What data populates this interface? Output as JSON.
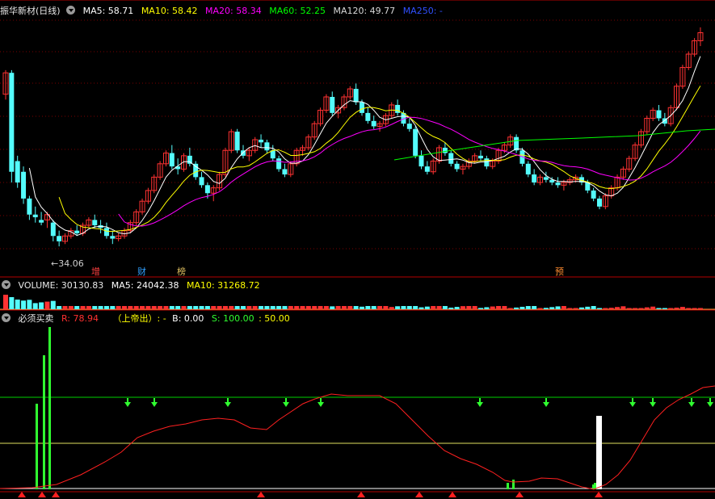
{
  "header": {
    "title": "振华新材(日线)",
    "ma": [
      {
        "label": "MA5: 58.71",
        "color": "#ffffff"
      },
      {
        "label": "MA10: 58.42",
        "color": "#ffff00"
      },
      {
        "label": "MA20: 58.34",
        "color": "#ff00ff"
      },
      {
        "label": "MA60: 52.25",
        "color": "#00ff00"
      },
      {
        "label": "MA120: 49.77",
        "color": "#d8d8d8"
      },
      {
        "label": "MA250: -",
        "color": "#3050ff"
      }
    ]
  },
  "price_panel": {
    "low_label": "34.06",
    "tags": [
      "增",
      "财",
      "榜",
      "预"
    ]
  },
  "volume_panel": {
    "title": "VOLUME: 30130.83",
    "ma5": "MA5: 24042.38",
    "ma10": "MA10: 31268.72"
  },
  "indicator_panel": {
    "title": "必须买卖",
    "r": "R: 78.94",
    "signal": "（上帝出）: -",
    "b": "B: 0.00",
    "s": "S: 100.00",
    "level": ": 50.00"
  },
  "colors": {
    "up": "#ff3232",
    "down": "#54fcfc",
    "grid": "#7a0000",
    "sep": "#b40000"
  },
  "chart_data": {
    "type": "candlestick",
    "title": "振华新材(日线)",
    "annotated_low": 34.06,
    "ma_values": {
      "MA5": 58.71,
      "MA10": 58.42,
      "MA20": 58.34,
      "MA60": 52.25,
      "MA120": 49.77
    },
    "volume": {
      "VOLUME": 30130.83,
      "MA5": 24042.38,
      "MA10": 31268.72
    },
    "indicator": {
      "R": 78.94,
      "B": 0.0,
      "S": 100.0,
      "level": 50.0
    },
    "candles_approx": [
      [
        62.5,
        67.0,
        61.5,
        66.5
      ],
      [
        66.5,
        67.0,
        46.0,
        48.0
      ],
      [
        50.0,
        51.0,
        45.0,
        46.0
      ],
      [
        48.0,
        49.0,
        42.0,
        43.0
      ],
      [
        43.0,
        43.5,
        39.0,
        40.0
      ],
      [
        40.0,
        41.5,
        38.5,
        39.5
      ],
      [
        39.0,
        40.5,
        38.0,
        38.5
      ],
      [
        39.0,
        40.5,
        37.5,
        40.0
      ],
      [
        38.5,
        39.0,
        35.0,
        36.0
      ],
      [
        36.0,
        37.0,
        34.06,
        35.0
      ],
      [
        35.0,
        36.5,
        34.5,
        36.0
      ],
      [
        36.0,
        37.5,
        35.5,
        37.0
      ],
      [
        37.0,
        38.0,
        36.0,
        36.5
      ],
      [
        36.5,
        38.5,
        36.0,
        38.0
      ],
      [
        38.0,
        39.5,
        37.5,
        39.0
      ],
      [
        39.0,
        40.0,
        37.5,
        38.0
      ],
      [
        38.0,
        39.0,
        36.5,
        37.5
      ],
      [
        37.5,
        38.5,
        35.5,
        36.0
      ],
      [
        36.0,
        37.0,
        34.5,
        35.5
      ],
      [
        35.5,
        36.5,
        35.0,
        36.0
      ],
      [
        36.0,
        37.5,
        35.5,
        37.0
      ],
      [
        37.0,
        39.0,
        36.5,
        38.5
      ],
      [
        38.5,
        41.0,
        38.0,
        40.5
      ],
      [
        40.5,
        43.0,
        40.0,
        42.5
      ],
      [
        42.5,
        45.0,
        42.0,
        44.5
      ],
      [
        44.5,
        47.5,
        44.0,
        47.0
      ],
      [
        47.0,
        50.0,
        46.5,
        49.5
      ],
      [
        49.5,
        52.0,
        49.0,
        51.5
      ],
      [
        51.5,
        53.0,
        48.5,
        49.0
      ],
      [
        49.0,
        50.5,
        47.5,
        48.5
      ],
      [
        48.5,
        51.5,
        48.0,
        51.0
      ],
      [
        51.0,
        52.5,
        49.0,
        49.5
      ],
      [
        49.5,
        50.0,
        46.5,
        47.0
      ],
      [
        47.0,
        48.0,
        45.0,
        45.5
      ],
      [
        45.5,
        46.0,
        43.0,
        44.0
      ],
      [
        44.0,
        45.5,
        42.5,
        45.0
      ],
      [
        45.0,
        48.0,
        44.5,
        47.5
      ],
      [
        47.5,
        52.5,
        47.0,
        52.0
      ],
      [
        52.0,
        56.0,
        51.5,
        55.5
      ],
      [
        55.5,
        56.0,
        51.5,
        52.0
      ],
      [
        52.0,
        53.0,
        50.5,
        51.0
      ],
      [
        51.0,
        52.5,
        50.0,
        52.0
      ],
      [
        52.0,
        54.5,
        51.5,
        54.0
      ],
      [
        54.0,
        55.0,
        52.5,
        53.5
      ],
      [
        53.5,
        54.0,
        51.5,
        52.0
      ],
      [
        52.0,
        53.0,
        50.0,
        50.5
      ],
      [
        50.5,
        51.0,
        48.0,
        48.5
      ],
      [
        48.5,
        49.5,
        47.0,
        47.5
      ],
      [
        47.5,
        50.0,
        47.0,
        49.5
      ],
      [
        49.5,
        52.5,
        49.0,
        52.0
      ],
      [
        52.0,
        53.0,
        51.0,
        52.5
      ],
      [
        52.5,
        55.0,
        52.0,
        54.5
      ],
      [
        54.5,
        57.5,
        54.0,
        57.0
      ],
      [
        57.0,
        60.0,
        56.5,
        59.5
      ],
      [
        59.5,
        62.5,
        59.0,
        62.0
      ],
      [
        62.0,
        63.0,
        58.5,
        59.0
      ],
      [
        59.0,
        60.5,
        58.0,
        60.0
      ],
      [
        60.0,
        62.5,
        59.5,
        62.0
      ],
      [
        62.0,
        64.0,
        61.5,
        63.5
      ],
      [
        63.5,
        64.5,
        60.5,
        61.0
      ],
      [
        61.0,
        61.5,
        58.5,
        59.0
      ],
      [
        59.0,
        60.0,
        57.0,
        57.5
      ],
      [
        57.5,
        58.5,
        56.0,
        56.5
      ],
      [
        56.5,
        57.5,
        55.5,
        57.0
      ],
      [
        57.0,
        59.0,
        56.5,
        58.5
      ],
      [
        58.5,
        61.0,
        58.0,
        60.5
      ],
      [
        60.5,
        61.5,
        58.5,
        59.0
      ],
      [
        59.0,
        59.5,
        56.5,
        57.0
      ],
      [
        57.0,
        58.0,
        55.5,
        56.0
      ],
      [
        56.0,
        56.5,
        50.5,
        51.0
      ],
      [
        51.0,
        52.0,
        48.5,
        49.0
      ],
      [
        49.0,
        50.0,
        47.5,
        48.0
      ],
      [
        48.0,
        50.5,
        47.5,
        50.0
      ],
      [
        50.0,
        53.0,
        49.5,
        52.5
      ],
      [
        52.5,
        53.5,
        51.0,
        51.5
      ],
      [
        51.5,
        52.0,
        49.0,
        49.5
      ],
      [
        49.5,
        50.0,
        48.0,
        48.5
      ],
      [
        48.5,
        49.5,
        47.5,
        49.0
      ],
      [
        49.0,
        50.5,
        48.5,
        50.0
      ],
      [
        50.0,
        51.5,
        49.5,
        51.0
      ],
      [
        51.0,
        52.0,
        50.0,
        50.5
      ],
      [
        50.5,
        51.0,
        48.5,
        49.0
      ],
      [
        49.0,
        50.5,
        48.5,
        50.0
      ],
      [
        50.0,
        52.5,
        49.5,
        52.0
      ],
      [
        52.0,
        53.5,
        51.5,
        53.0
      ],
      [
        53.0,
        55.0,
        52.5,
        54.5
      ],
      [
        54.5,
        55.0,
        51.5,
        52.0
      ],
      [
        52.0,
        52.5,
        49.0,
        49.5
      ],
      [
        49.5,
        50.0,
        47.0,
        47.5
      ],
      [
        47.5,
        48.5,
        45.5,
        46.0
      ],
      [
        46.0,
        47.5,
        45.5,
        47.0
      ],
      [
        47.0,
        48.0,
        46.0,
        46.5
      ],
      [
        46.5,
        47.0,
        45.5,
        46.0
      ],
      [
        46.0,
        47.0,
        45.0,
        45.5
      ],
      [
        45.5,
        46.5,
        44.5,
        46.0
      ],
      [
        46.0,
        47.0,
        45.5,
        46.5
      ],
      [
        46.5,
        47.5,
        46.0,
        47.0
      ],
      [
        47.0,
        47.5,
        45.5,
        46.0
      ],
      [
        46.0,
        46.5,
        44.0,
        44.5
      ],
      [
        44.5,
        45.0,
        42.5,
        43.0
      ],
      [
        43.0,
        43.5,
        41.0,
        41.5
      ],
      [
        41.5,
        44.0,
        41.0,
        43.5
      ],
      [
        43.5,
        45.5,
        43.0,
        45.0
      ],
      [
        45.0,
        47.5,
        44.5,
        47.0
      ],
      [
        47.0,
        49.0,
        46.5,
        48.5
      ],
      [
        48.5,
        51.0,
        48.0,
        50.5
      ],
      [
        50.5,
        53.5,
        50.0,
        53.0
      ],
      [
        53.0,
        56.0,
        52.5,
        55.5
      ],
      [
        55.5,
        58.5,
        55.0,
        58.0
      ],
      [
        58.0,
        60.0,
        57.5,
        59.5
      ],
      [
        59.5,
        60.5,
        57.5,
        58.0
      ],
      [
        58.0,
        59.0,
        56.5,
        57.0
      ],
      [
        57.0,
        60.5,
        56.5,
        60.0
      ],
      [
        60.0,
        64.5,
        59.5,
        64.0
      ],
      [
        64.0,
        68.0,
        63.5,
        67.5
      ],
      [
        67.5,
        70.5,
        67.0,
        70.0
      ],
      [
        70.0,
        73.0,
        69.5,
        72.5
      ],
      [
        72.5,
        75.0,
        71.5,
        74.0
      ]
    ]
  }
}
